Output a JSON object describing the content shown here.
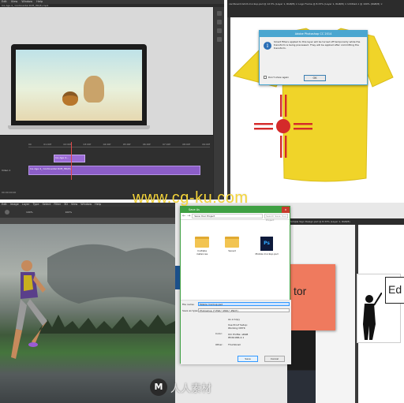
{
  "q1": {
    "menu": [
      "Edit",
      "View",
      "Window",
      "Help"
    ],
    "doc_tab": "Ice Age 4_ Continental Drift_HD(8).mp4",
    "timeline_ruler": [
      "00",
      "01:00f",
      "02:00f",
      "03:00f",
      "04:00f",
      "05:00f",
      "06:00f",
      "07:00f",
      "08:00f",
      "09:00f"
    ],
    "clip_a": "Ice Age 4_ Continental Drift_HD(8).",
    "clip_b": "Ice Age 4...",
    "track": "Video 1",
    "footer": "00:00:00:00"
  },
  "q2": {
    "tabs": "cardboard-tshirt-mockup.psd @ 12.5% (Layer 1, RGB/8) ×   Logo Frame @ 8.33% (Layer 1, RGB/8) ×   Untitled-1 @ 100% (RGB/8) ×",
    "dialog": {
      "title": "Adobe Photoshop CC 2014",
      "message": "Smart Filters applied to this layer will be turned off temporarily while the transform is being previewed. They will be applied after committing the transform.",
      "checkbox": "Don't show again",
      "ok": "OK"
    }
  },
  "q3": {
    "menu": [
      "Edit",
      "Image",
      "Layer",
      "Type",
      "Select",
      "Filter",
      "3D",
      "View",
      "Window",
      "Help"
    ],
    "zoom": "100%",
    "flow": "100%"
  },
  "q4": {
    "window_title": "Save As",
    "address": "Save Your Project",
    "search_placeholder": "Search Save Your Project",
    "files": [
      {
        "name": "multiple instances",
        "type": "folder"
      },
      {
        "name": "Saved",
        "type": "folder"
      },
      {
        "name": "Mobile mockup.psd",
        "type": "psd"
      }
    ],
    "file_name_label": "File name:",
    "file_name": "Mobile mockup.psd",
    "save_type_label": "Save as type:",
    "save_type": "Photoshop (*.PSD;*.PDD;*.PSDT)",
    "options": [
      "As a Copy",
      "Notes",
      "Alpha Channels",
      "Spot Colors",
      "Layers"
    ],
    "color_label": "Color:",
    "color_options": [
      "Use Proof Setup: Working CMYK",
      "ICC Profile: sRGB IEC61966-2.1"
    ],
    "other_label": "Other:",
    "other_option": "Thumbnail",
    "save": "Save",
    "cancel": "Cancel",
    "hide_folders": "Hide Folders",
    "tab": "Simple Sign Design.psd @ 8.33% (Layer 1, RGB/8)",
    "sign_text_1": "tor",
    "sign_text_2": "Ed"
  },
  "watermark": "www.cg-ku.com",
  "logo_text": "人人素材",
  "colors": {
    "ps_dark": "#383838",
    "purple": "#8c5ec8",
    "shirt": "#f0d429",
    "watermark": "#f5d53a",
    "zia": "#d42a2a"
  }
}
